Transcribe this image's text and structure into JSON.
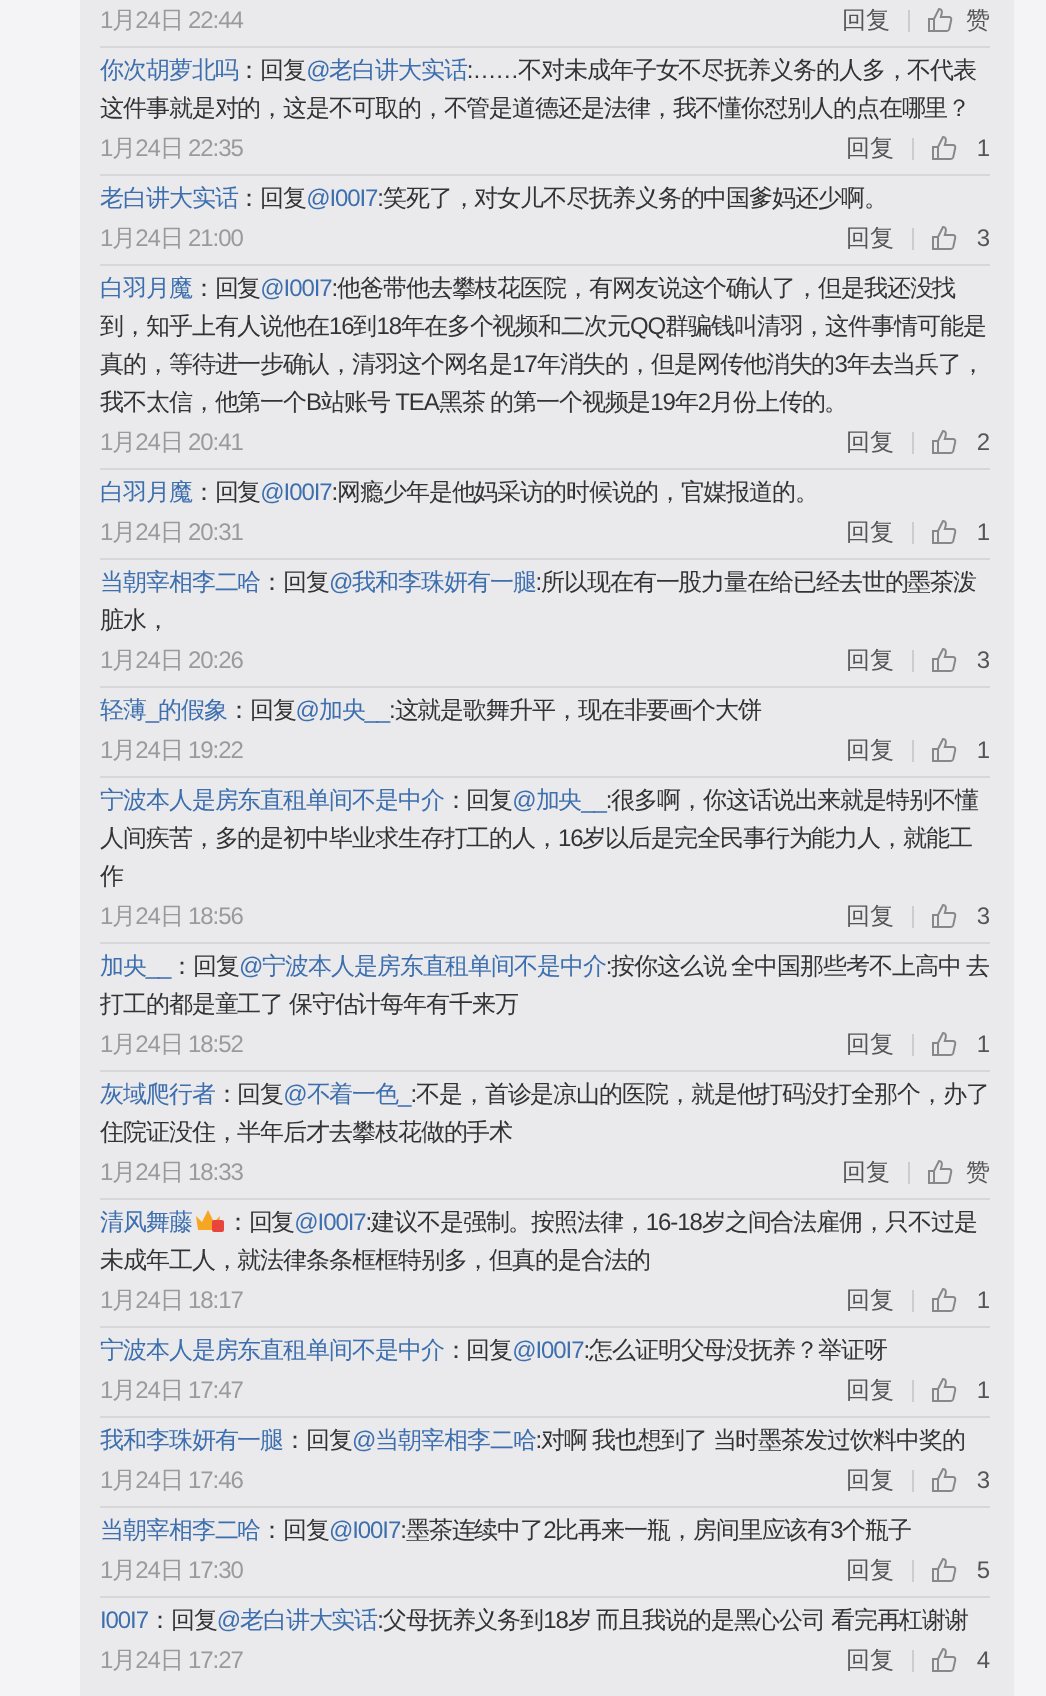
{
  "comments": [
    {
      "time": "1月24日 22:44",
      "reply": "回复",
      "likes": "赞"
    },
    {
      "author": "你次胡萝北吗",
      "vip_badge": false,
      "prefix": "：回复",
      "reply_to": "@老白讲大实话",
      "text": ":……不对未成年子女不尽抚养义务的人多，不代表这件事就是对的，这是不可取的，不管是道德还是法律，我不懂你怼别人的点在哪里？",
      "time": "1月24日 22:35",
      "reply": "回复",
      "likes": "1"
    },
    {
      "author": "老白讲大实话",
      "vip_badge": false,
      "prefix": "：回复",
      "reply_to": "@I00I7",
      "text": ":笑死了，对女儿不尽抚养义务的中国爹妈还少啊。",
      "time": "1月24日 21:00",
      "reply": "回复",
      "likes": "3"
    },
    {
      "author": "白羽月魔",
      "vip_badge": false,
      "prefix": "：回复",
      "reply_to": "@I00I7",
      "text": ":他爸带他去攀枝花医院，有网友说这个确认了，但是我还没找到，知乎上有人说他在16到18年在多个视频和二次元QQ群骗钱叫清羽，这件事情可能是真的，等待进一步确认，清羽这个网名是17年消失的，但是网传他消失的3年去当兵了，我不太信，他第一个B站账号 TEA黑茶 的第一个视频是19年2月份上传的。",
      "time": "1月24日 20:41",
      "reply": "回复",
      "likes": "2"
    },
    {
      "author": "白羽月魔",
      "vip_badge": false,
      "prefix": "：回复",
      "reply_to": "@I00I7",
      "text": ":网瘾少年是他妈采访的时候说的，官媒报道的。",
      "time": "1月24日 20:31",
      "reply": "回复",
      "likes": "1"
    },
    {
      "author": "当朝宰相李二哈",
      "vip_badge": false,
      "prefix": "：回复",
      "reply_to": "@我和李珠妍有一腿",
      "text": ":所以现在有一股力量在给已经去世的墨茶泼脏水，",
      "time": "1月24日 20:26",
      "reply": "回复",
      "likes": "3"
    },
    {
      "author": "轻薄_的假象",
      "vip_badge": false,
      "prefix": "：回复",
      "reply_to": "@加央__",
      "text": ":这就是歌舞升平，现在非要画个大饼",
      "time": "1月24日 19:22",
      "reply": "回复",
      "likes": "1"
    },
    {
      "author": "宁波本人是房东直租单间不是中介",
      "vip_badge": false,
      "prefix": "：回复",
      "reply_to": "@加央__",
      "text": ":很多啊，你这话说出来就是特别不懂人间疾苦，多的是初中毕业求生存打工的人，16岁以后是完全民事行为能力人，就能工作",
      "time": "1月24日 18:56",
      "reply": "回复",
      "likes": "3"
    },
    {
      "author": "加央__",
      "vip_badge": false,
      "prefix": "：回复",
      "reply_to": "@宁波本人是房东直租单间不是中介",
      "text": ":按你这么说 全中国那些考不上高中 去打工的都是童工了  保守估计每年有千来万",
      "time": "1月24日 18:52",
      "reply": "回复",
      "likes": "1"
    },
    {
      "author": "灰域爬行者",
      "vip_badge": false,
      "prefix": "：回复",
      "reply_to": "@不着一色_",
      "text": ":不是，首诊是凉山的医院，就是他打码没打全那个，办了住院证没住，半年后才去攀枝花做的手术",
      "time": "1月24日 18:33",
      "reply": "回复",
      "likes": "赞"
    },
    {
      "author": "清风舞藤",
      "vip_badge": true,
      "prefix": "：回复",
      "reply_to": "@I00I7",
      "text": ":建议不是强制。按照法律，16-18岁之间合法雇佣，只不过是未成年工人，就法律条条框框特别多，但真的是合法的",
      "time": "1月24日 18:17",
      "reply": "回复",
      "likes": "1"
    },
    {
      "author": "宁波本人是房东直租单间不是中介",
      "vip_badge": false,
      "prefix": "：回复",
      "reply_to": "@I00I7",
      "text": ":怎么证明父母没抚养？举证呀",
      "time": "1月24日 17:47",
      "reply": "回复",
      "likes": "1"
    },
    {
      "author": "我和李珠妍有一腿",
      "vip_badge": false,
      "prefix": "：回复",
      "reply_to": "@当朝宰相李二哈",
      "text": ":对啊 我也想到了 当时墨茶发过饮料中奖的",
      "time": "1月24日 17:46",
      "reply": "回复",
      "likes": "3"
    },
    {
      "author": "当朝宰相李二哈",
      "vip_badge": false,
      "prefix": "：回复",
      "reply_to": "@I00I7",
      "text": ":墨茶连续中了2比再来一瓶，房间里应该有3个瓶子",
      "time": "1月24日 17:30",
      "reply": "回复",
      "likes": "5"
    },
    {
      "author": "I00I7",
      "vip_badge": false,
      "prefix": "：回复",
      "reply_to": "@老白讲大实话",
      "text": ":父母抚养义务到18岁 而且我说的是黑心公司 看完再杠谢谢",
      "time": "1月24日 17:27",
      "reply": "回复",
      "likes": "4"
    }
  ]
}
